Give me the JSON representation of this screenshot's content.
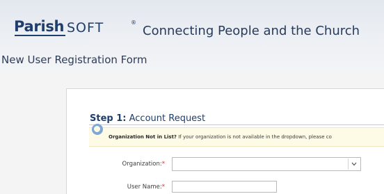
{
  "header": {
    "logo": {
      "parish": "Parish",
      "soft": "SOFT",
      "tm": "®"
    },
    "tagline": "Connecting People and the Church",
    "page_title": "New User Registration Form"
  },
  "form": {
    "step": {
      "number": "Step 1:",
      "title": "Account Request"
    },
    "notice": {
      "bold": "Organization Not in List?",
      "text": "If your organization is not available in the dropdown, please co"
    },
    "organization": {
      "label": "Organization:",
      "required": "*",
      "selected": ""
    },
    "username": {
      "label": "User Name:",
      "required": "*",
      "value": ""
    }
  },
  "icons": {
    "notice": "info-icon",
    "dropdown": "chevron-down-icon"
  },
  "colors": {
    "brand": "#1f3e6b",
    "required": "#d42a2a",
    "notice_bg": "#fdfbe6"
  }
}
